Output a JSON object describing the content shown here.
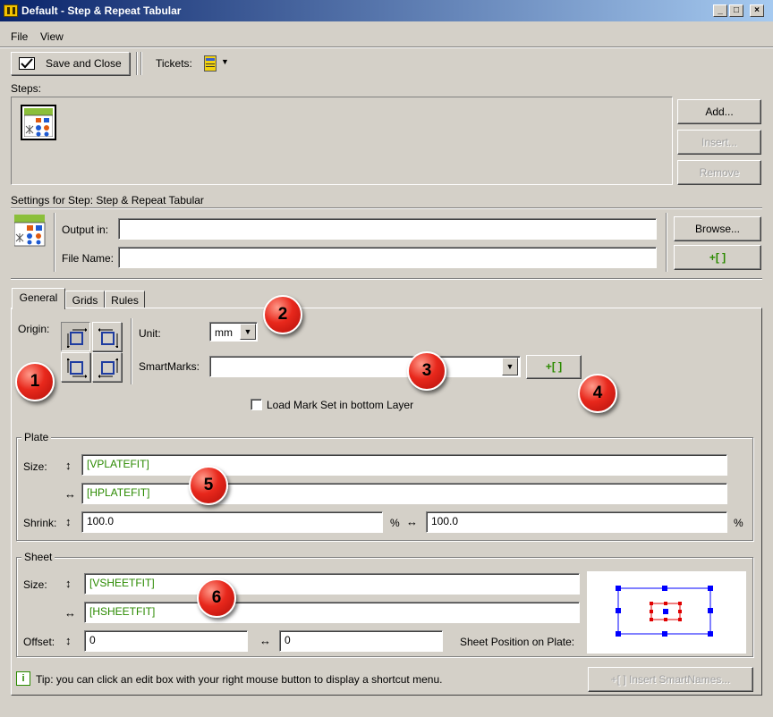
{
  "window": {
    "title": "Default - Step & Repeat Tabular",
    "minimize": "_",
    "maximize": "□",
    "close": "×"
  },
  "menu": [
    "File",
    "View"
  ],
  "toolbar": {
    "save_close_label": "Save and Close",
    "tickets_label": "Tickets:"
  },
  "steps": {
    "label": "Steps:",
    "add": "Add...",
    "insert": "Insert...",
    "remove": "Remove"
  },
  "settings": {
    "header": "Settings for Step: Step & Repeat Tabular",
    "output_label": "Output in:",
    "output_value": "",
    "filename_label": "File Name:",
    "filename_value": "",
    "browse": "Browse...",
    "smartname_button": "+[ ]"
  },
  "tabs": [
    "General",
    "Grids",
    "Rules"
  ],
  "general": {
    "origin_label": "Origin:",
    "unit_label": "Unit:",
    "unit_value": "mm",
    "smartmarks_label": "SmartMarks:",
    "smartmarks_value": "",
    "smartmarks_button": "+[ ]",
    "load_mark_set_label": "Load Mark Set in bottom Layer",
    "load_mark_set_checked": false
  },
  "plate": {
    "legend": "Plate",
    "size_label": "Size:",
    "v_icon": "↕",
    "h_icon": "↔",
    "vsize": "[VPLATEFIT]",
    "hsize": "[HPLATEFIT]",
    "shrink_label": "Shrink:",
    "shrink_v": "100.0",
    "shrink_h": "100.0",
    "percent": "%"
  },
  "sheet": {
    "legend": "Sheet",
    "size_label": "Size:",
    "vsize": "[VSHEETFIT]",
    "hsize": "[HSHEETFIT]",
    "offset_label": "Offset:",
    "offset_v": "0",
    "offset_h": "0",
    "position_label": "Sheet Position on Plate:"
  },
  "footer": {
    "tip": "Tip: you can click an edit box with your right mouse button to display a shortcut menu.",
    "tip_icon": "i",
    "insert_smartnames": "+[ ] Insert SmartNames..."
  },
  "callouts": [
    "1",
    "2",
    "3",
    "4",
    "5",
    "6"
  ],
  "colors": {
    "title_start": "#0a246a",
    "title_end": "#a6caf0",
    "smartname_green": "#2b8a00",
    "callout_red": "#e8281c",
    "handle_blue": "#0000ff"
  }
}
